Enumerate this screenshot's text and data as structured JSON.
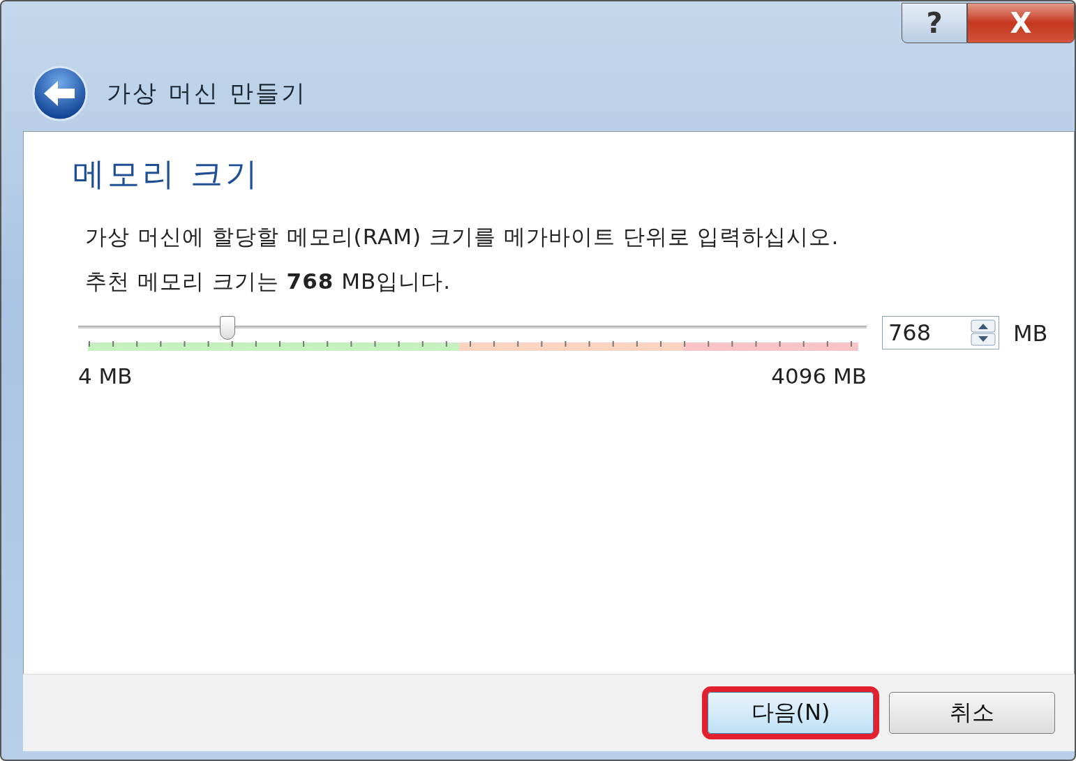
{
  "window": {
    "title": "가상 머신 만들기",
    "buttons": [
      {
        "kind": "help",
        "label": "?"
      },
      {
        "kind": "close",
        "label": "X"
      }
    ]
  },
  "page": {
    "heading": "메모리 크기",
    "description": "가상 머신에 할당할 메모리(RAM) 크기를 메가바이트 단위로 입력하십시오.",
    "recommendation": "추천 메모리 크기는 **768** MB입니다."
  },
  "memory": {
    "level": 0.19,
    "min_label": "4 MB",
    "max_label": "4096 MB",
    "value": "768",
    "unit": "MB"
  },
  "footer": {
    "buttons": [
      {
        "label": "다음(N)",
        "highlighted": true
      },
      {
        "label": "취소",
        "highlighted": false
      }
    ]
  }
}
